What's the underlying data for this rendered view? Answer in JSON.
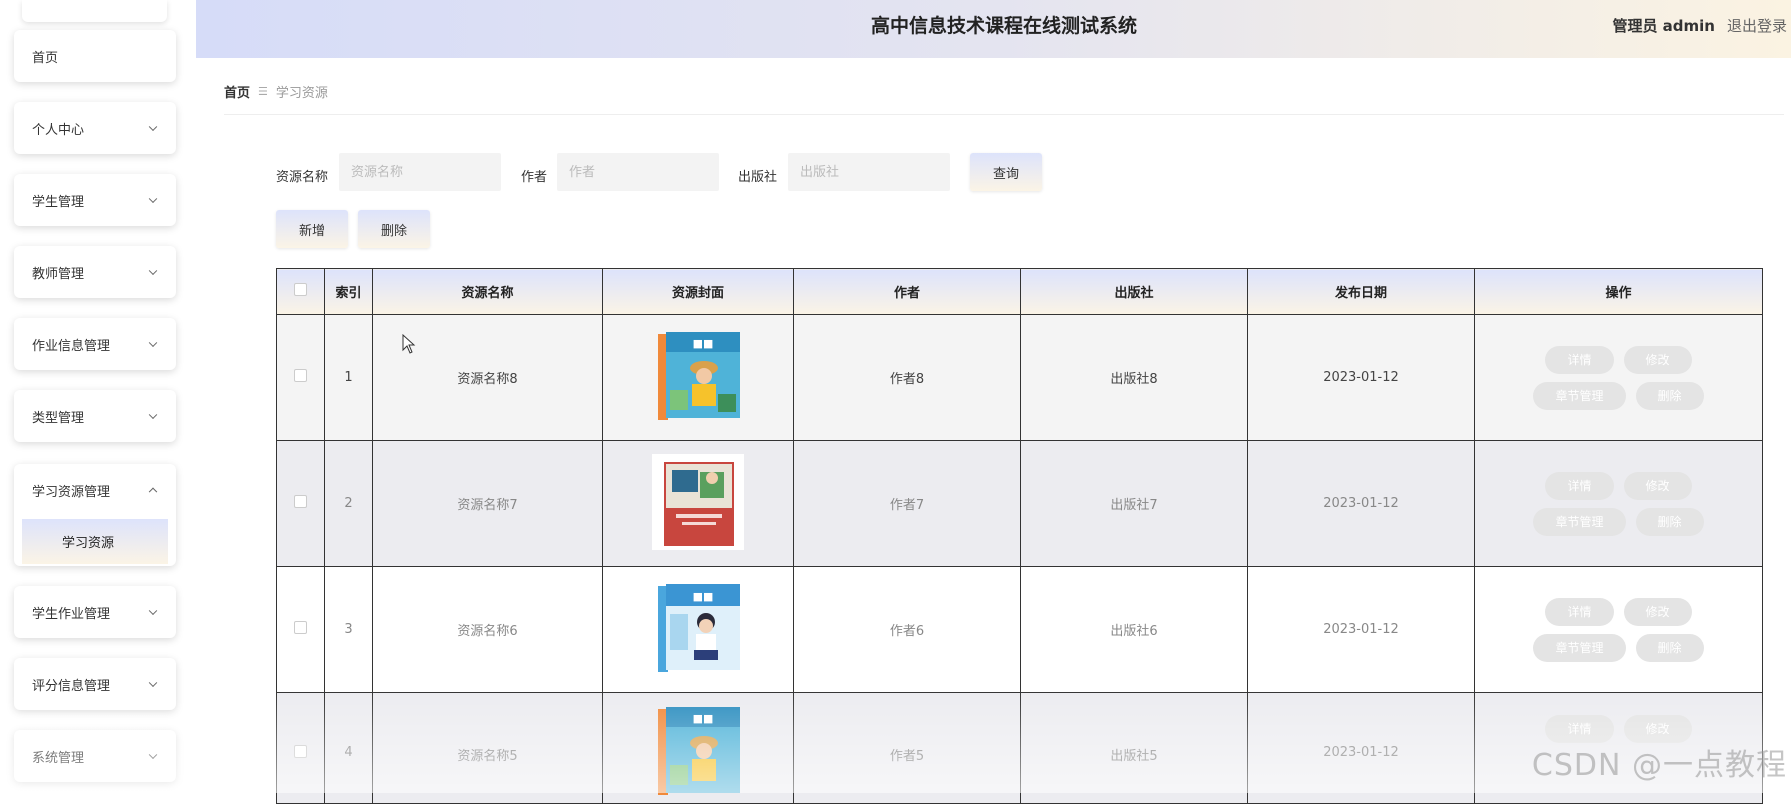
{
  "header": {
    "title": "高中信息技术课程在线测试系统",
    "user": "管理员 admin",
    "logout": "退出登录"
  },
  "sidebar": {
    "items": [
      {
        "label": "首页",
        "has_arrow": false
      },
      {
        "label": "个人中心",
        "has_arrow": true
      },
      {
        "label": "学生管理",
        "has_arrow": true
      },
      {
        "label": "教师管理",
        "has_arrow": true
      },
      {
        "label": "作业信息管理",
        "has_arrow": true
      },
      {
        "label": "类型管理",
        "has_arrow": true
      },
      {
        "label": "学习资源管理",
        "has_arrow": true,
        "expanded": true,
        "children": [
          "学习资源"
        ]
      },
      {
        "label": "学生作业管理",
        "has_arrow": true
      },
      {
        "label": "评分信息管理",
        "has_arrow": true
      },
      {
        "label": "系统管理",
        "has_arrow": true
      }
    ]
  },
  "breadcrumb": {
    "home": "首页",
    "current": "学习资源"
  },
  "search": {
    "name_label": "资源名称",
    "name_placeholder": "资源名称",
    "author_label": "作者",
    "author_placeholder": "作者",
    "publisher_label": "出版社",
    "publisher_placeholder": "出版社",
    "query_button": "查询"
  },
  "actions": {
    "add": "新增",
    "delete": "删除"
  },
  "table": {
    "headers": [
      "索引",
      "资源名称",
      "资源封面",
      "作者",
      "出版社",
      "发布日期",
      "操作"
    ],
    "rows": [
      {
        "index": "1",
        "name": "资源名称8",
        "author": "作者8",
        "publisher": "出版社8",
        "date": "2023-01-12"
      },
      {
        "index": "2",
        "name": "资源名称7",
        "author": "作者7",
        "publisher": "出版社7",
        "date": "2023-01-12"
      },
      {
        "index": "3",
        "name": "资源名称6",
        "author": "作者6",
        "publisher": "出版社6",
        "date": "2023-01-12"
      },
      {
        "index": "4",
        "name": "资源名称5",
        "author": "作者5",
        "publisher": "出版社5",
        "date": "2023-01-12"
      }
    ],
    "ops": {
      "detail": "详情",
      "edit": "修改",
      "chapters": "章节管理",
      "delete": "删除"
    }
  },
  "watermark": "CSDN @一点教程",
  "colors": {
    "accent_start": "#dde3fb",
    "accent_end": "#fbf4e6"
  }
}
